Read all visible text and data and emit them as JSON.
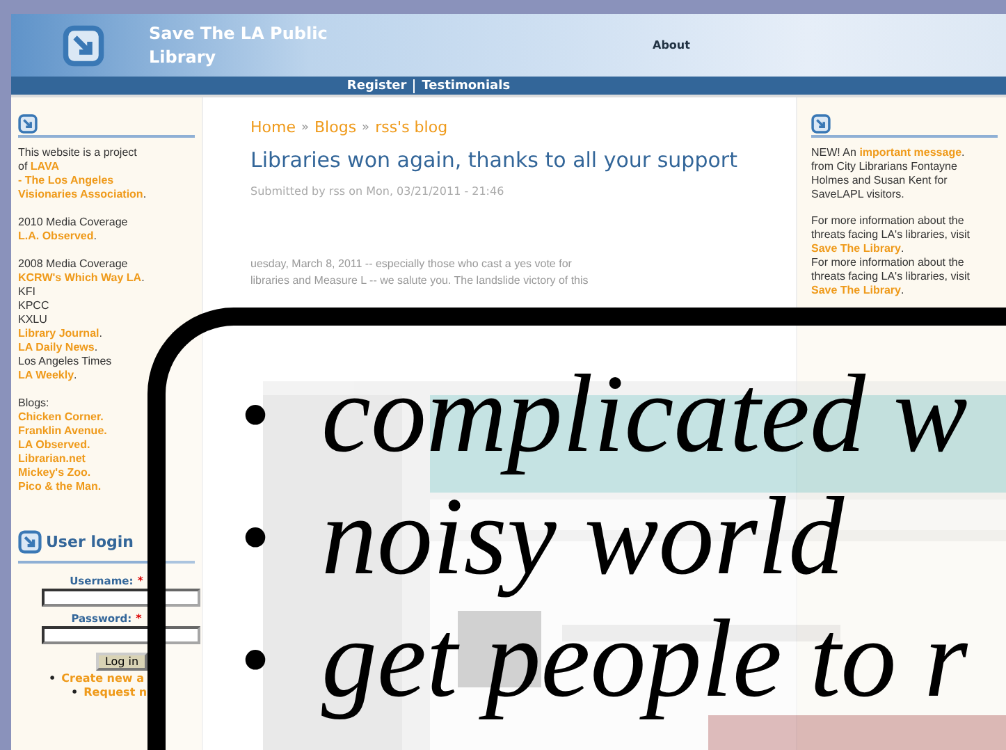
{
  "header": {
    "site_title": "Save The LA Public Library",
    "nav_link": "About"
  },
  "nav_bar": {
    "links": [
      "Register",
      "Testimonials"
    ]
  },
  "left_sidebar": {
    "blocks": [
      [
        [
          {
            "text": "This website is a project"
          }
        ],
        [
          {
            "text": "of "
          },
          {
            "text": "LAVA",
            "link": true
          }
        ],
        [
          {
            "text": "- The Los Angeles",
            "link": true
          }
        ],
        [
          {
            "text": "Visionaries Association",
            "link": true
          },
          {
            "text": "."
          }
        ]
      ],
      [
        [
          {
            "text": "2010 Media Coverage"
          }
        ],
        [
          {
            "text": "L.A. Observed",
            "link": true
          },
          {
            "text": "."
          }
        ]
      ],
      [
        [
          {
            "text": "2008 Media Coverage"
          }
        ],
        [
          {
            "text": "KCRW's Which Way LA",
            "link": true
          },
          {
            "text": "."
          }
        ],
        [
          {
            "text": "KFI"
          }
        ],
        [
          {
            "text": "KPCC"
          }
        ],
        [
          {
            "text": "KXLU"
          }
        ],
        [
          {
            "text": "Library Journal",
            "link": true
          },
          {
            "text": "."
          }
        ],
        [
          {
            "text": "LA Daily News",
            "link": true
          },
          {
            "text": "."
          }
        ],
        [
          {
            "text": "Los Angeles Times"
          }
        ],
        [
          {
            "text": "LA Weekly",
            "link": true
          },
          {
            "text": "."
          }
        ]
      ],
      [
        [
          {
            "text": "Blogs:"
          }
        ],
        [
          {
            "text": "Chicken Corner.",
            "link": true
          }
        ],
        [
          {
            "text": "Franklin Avenue.",
            "link": true
          }
        ],
        [
          {
            "text": "LA Observed.",
            "link": true
          }
        ],
        [
          {
            "text": "Librarian.net",
            "link": true
          }
        ],
        [
          {
            "text": "Mickey's Zoo.",
            "link": true
          }
        ],
        [
          {
            "text": "Pico & the Man.",
            "link": true
          }
        ]
      ]
    ],
    "login": {
      "title": "User login",
      "fields": [
        {
          "label": "Username:",
          "required_mark": "*"
        },
        {
          "label": "Password:",
          "required_mark": "*"
        }
      ],
      "button": "Log in",
      "bullet": "•",
      "links": [
        {
          "text": "Create new a",
          "children": [
            {
              "text": "Request n"
            }
          ]
        }
      ]
    }
  },
  "main": {
    "breadcrumb": {
      "items": [
        "Home",
        "Blogs",
        "rss's blog"
      ],
      "separator": "»"
    },
    "title": "Libraries won again, thanks to all your support",
    "submitted": "Submitted by rss on Mon, 03/21/2011 - 21:46",
    "body_lines": [
      "uesday, March 8, 2011 -- especially those who cast a yes vote for",
      "libraries and Measure L -- we salute you. The landslide victory of this"
    ]
  },
  "right_sidebar": {
    "blocks": [
      [
        [
          {
            "text": "NEW! An "
          },
          {
            "text": "important message",
            "link": true
          },
          {
            "text": "."
          }
        ],
        [
          {
            "text": "from City Librarians Fontayne"
          }
        ],
        [
          {
            "text": "Holmes and Susan Kent for"
          }
        ],
        [
          {
            "text": "SaveLAPL visitors."
          }
        ]
      ],
      [
        [
          {
            "text": "For more information about the"
          }
        ],
        [
          {
            "text": "threats facing LA's libraries, visit"
          }
        ],
        [
          {
            "text": "Save The Library",
            "link": true
          },
          {
            "text": "."
          }
        ],
        [
          {
            "text": "For more information about the"
          }
        ],
        [
          {
            "text": "threats facing LA's libraries, visit"
          }
        ],
        [
          {
            "text": "Save The Library",
            "link": true
          },
          {
            "text": "."
          }
        ]
      ]
    ]
  },
  "callout": {
    "marker": "•",
    "items": [
      "complicated w",
      "noisy world",
      "get people to r"
    ]
  }
}
